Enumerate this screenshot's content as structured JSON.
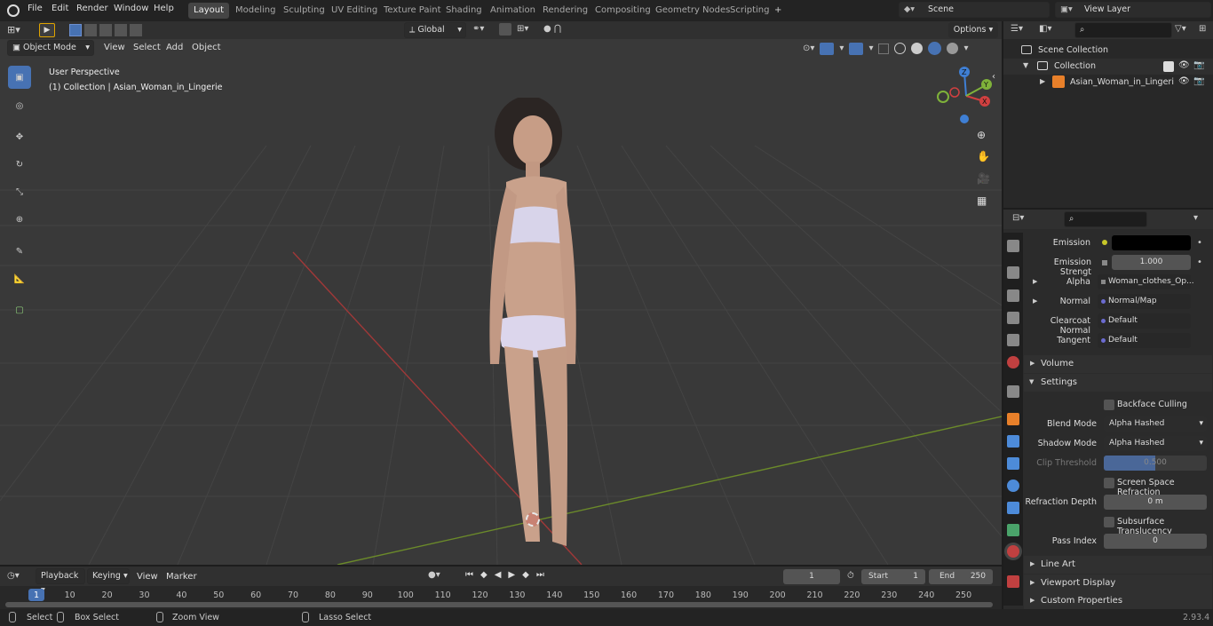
{
  "topbar": {
    "menus": [
      "File",
      "Edit",
      "Render",
      "Window",
      "Help"
    ],
    "tabs": [
      "Layout",
      "Modeling",
      "Sculpting",
      "UV Editing",
      "Texture Paint",
      "Shading",
      "Animation",
      "Rendering",
      "Compositing",
      "Geometry Nodes",
      "Scripting"
    ],
    "active_tab": "Layout",
    "scene": "Scene",
    "view_layer": "View Layer"
  },
  "viewport_header": {
    "mode": "Object Mode",
    "menus": [
      "View",
      "Select",
      "Add",
      "Object"
    ],
    "orientation": "Global",
    "options": "Options"
  },
  "viewport": {
    "perspective": "User Perspective",
    "collection_info": "(1) Collection | Asian_Woman_in_Lingerie",
    "axes": {
      "x": "X",
      "y": "Y",
      "z": "Z"
    }
  },
  "outliner": {
    "root": "Scene Collection",
    "collection": "Collection",
    "object": "Asian_Woman_in_Lingeri"
  },
  "properties": {
    "emission": {
      "label": "Emission",
      "value": ""
    },
    "emission_strength": {
      "label": "Emission Strengt",
      "value": "1.000"
    },
    "alpha": {
      "label": "Alpha",
      "value": "Woman_clothes_Op..."
    },
    "normal": {
      "label": "Normal",
      "value": "Normal/Map"
    },
    "clearcoat_normal": {
      "label": "Clearcoat Normal",
      "value": "Default"
    },
    "tangent": {
      "label": "Tangent",
      "value": "Default"
    },
    "volume": "Volume",
    "settings": "Settings",
    "backface_culling": "Backface Culling",
    "blend_mode": {
      "label": "Blend Mode",
      "value": "Alpha Hashed"
    },
    "shadow_mode": {
      "label": "Shadow Mode",
      "value": "Alpha Hashed"
    },
    "clip_threshold": {
      "label": "Clip Threshold",
      "value": "0.500"
    },
    "screen_space_refraction": "Screen Space Refraction",
    "refraction_depth": {
      "label": "Refraction Depth",
      "value": "0 m"
    },
    "subsurface_translucency": "Subsurface Translucency",
    "pass_index": {
      "label": "Pass Index",
      "value": "0"
    },
    "line_art": "Line Art",
    "viewport_display": "Viewport Display",
    "custom_properties": "Custom Properties"
  },
  "timeline": {
    "menus": [
      "Playback",
      "Keying",
      "View",
      "Marker"
    ],
    "current_frame": "1",
    "start_label": "Start",
    "start": "1",
    "end_label": "End",
    "end": "250",
    "ticks": [
      "1",
      "10",
      "20",
      "30",
      "40",
      "50",
      "60",
      "70",
      "80",
      "90",
      "100",
      "110",
      "120",
      "130",
      "140",
      "150",
      "160",
      "170",
      "180",
      "190",
      "200",
      "210",
      "220",
      "230",
      "240",
      "250"
    ]
  },
  "statusbar": {
    "select": "Select",
    "box_select": "Box Select",
    "zoom_view": "Zoom View",
    "lasso_select": "Lasso Select",
    "version": "2.93.4"
  }
}
